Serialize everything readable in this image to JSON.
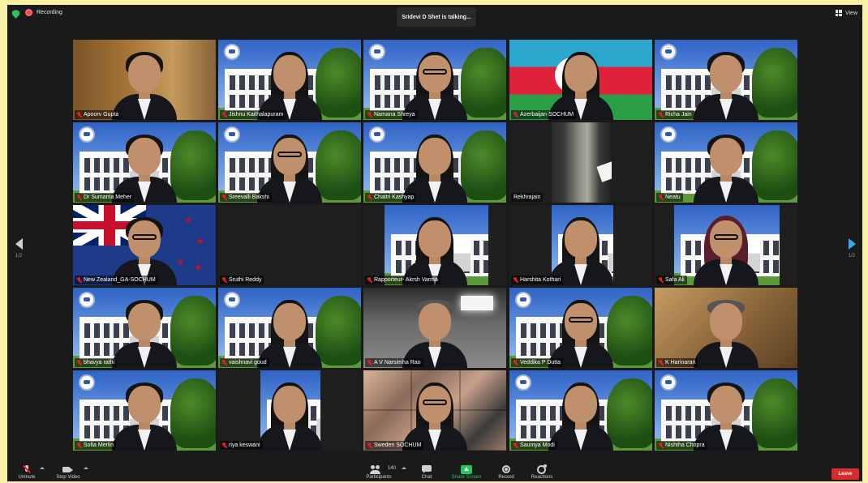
{
  "topbar": {
    "recording_label": "Recording",
    "talking_banner": "Sridevi D Shet is talking...",
    "view_label": "View"
  },
  "pager": {
    "left_page": "1/2",
    "right_page": "1/2"
  },
  "participants": [
    {
      "name": "Apoorv Gupta",
      "bg": "office",
      "muted": true
    },
    {
      "name": "Jishnu Kaithalapuram",
      "bg": "building",
      "muted": true
    },
    {
      "name": "Namana Shreya",
      "bg": "building",
      "muted": true
    },
    {
      "name": "Azerbaijan SOCHUM",
      "bg": "azerbaijan",
      "muted": true
    },
    {
      "name": "Richa Jain",
      "bg": "building",
      "muted": true
    },
    {
      "name": "Dr Sumanta Meher",
      "bg": "building",
      "muted": true
    },
    {
      "name": "Sreevalli Bakshi",
      "bg": "building",
      "muted": true
    },
    {
      "name": "Chaitri Kashyap",
      "bg": "building",
      "muted": true
    },
    {
      "name": "Rekhrajain",
      "bg": "darkroom",
      "muted": false
    },
    {
      "name": "Neatu",
      "bg": "building",
      "muted": true
    },
    {
      "name": "New Zealand_GA-SOCHUM",
      "bg": "newzealand",
      "muted": true
    },
    {
      "name": "Sruthi Reddy",
      "bg": "empty",
      "muted": true
    },
    {
      "name": "Rapporteur- Akrsh Varma",
      "bg": "building-partial",
      "muted": true
    },
    {
      "name": "Harshita Kothari",
      "bg": "building-partial",
      "muted": true
    },
    {
      "name": "Safa Ali",
      "bg": "building-partial",
      "muted": true
    },
    {
      "name": "bhavya rathi",
      "bg": "building",
      "muted": true
    },
    {
      "name": "vaishnavi goud",
      "bg": "building",
      "muted": true
    },
    {
      "name": "A V Narsimha Rao",
      "bg": "ceiling",
      "muted": true
    },
    {
      "name": "Veddika P Dutta",
      "bg": "building",
      "muted": true
    },
    {
      "name": "K Harinarari",
      "bg": "wall",
      "muted": true
    },
    {
      "name": "Sofia Merlin",
      "bg": "building",
      "muted": true
    },
    {
      "name": "riya keswani",
      "bg": "building-partial",
      "muted": true
    },
    {
      "name": "Sweden SOCHUM",
      "bg": "collage",
      "muted": true
    },
    {
      "name": "Saumya Modi",
      "bg": "building",
      "muted": true
    },
    {
      "name": "Nishtha Chopra",
      "bg": "building",
      "muted": true
    }
  ],
  "toolbar": {
    "unmute": "Unmute",
    "stop_video": "Stop Video",
    "participants": "Participants",
    "participants_count": "140",
    "chat": "Chat",
    "share_screen": "Share Screen",
    "record": "Record",
    "reactions": "Reactions",
    "leave": "Leave"
  },
  "colors": {
    "outer_background": "#f7f0a6",
    "app_background": "#1a1a1a",
    "share_green": "#22c55e",
    "leave_red": "#d92b2b",
    "mute_red": "#e11d2a",
    "pager_blue": "#39a9f0"
  }
}
